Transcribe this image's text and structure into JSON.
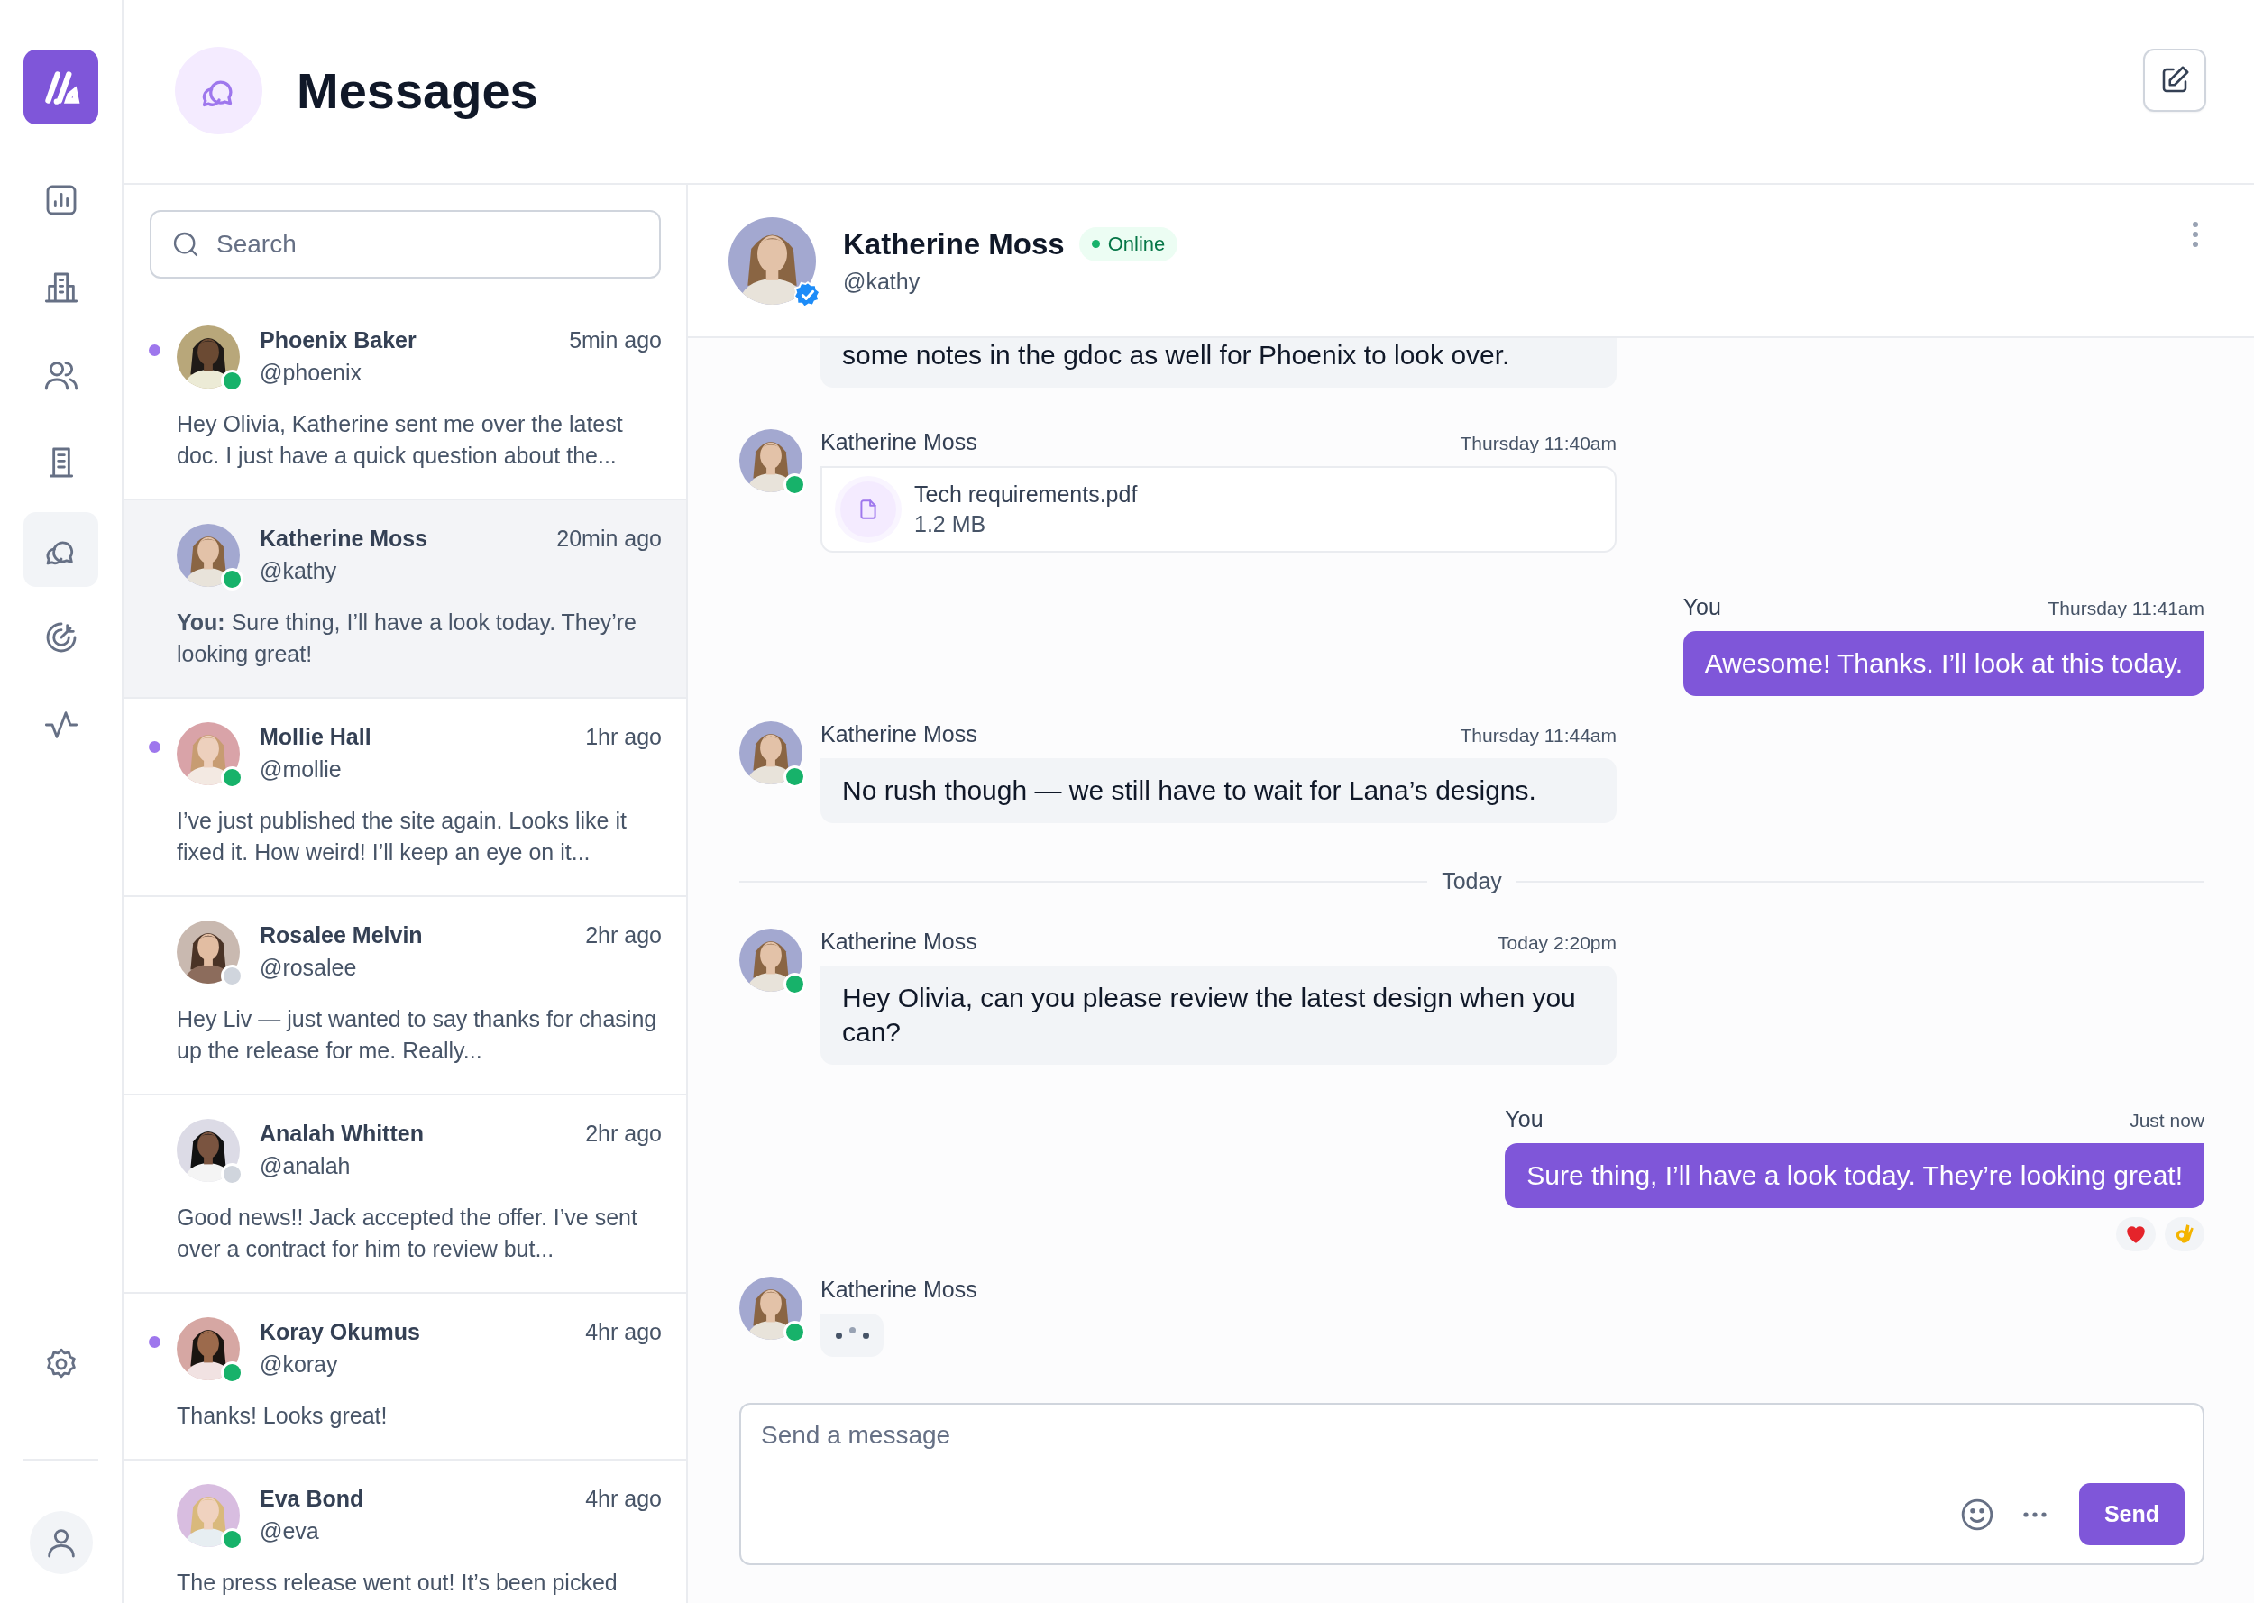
{
  "nav": [
    {
      "kind": "chart",
      "selected": false
    },
    {
      "kind": "building",
      "selected": false
    },
    {
      "kind": "users",
      "selected": false
    },
    {
      "kind": "document",
      "selected": false
    },
    {
      "kind": "messages",
      "selected": true
    },
    {
      "kind": "target",
      "selected": false
    },
    {
      "kind": "activity",
      "selected": false
    }
  ],
  "page_title": "Messages",
  "search": {
    "placeholder": "Search"
  },
  "conversations": [
    {
      "name": "Phoenix Baker",
      "handle": "@phoenix",
      "time": "5min ago",
      "preview": "Hey Olivia, Katherine sent me over the latest doc. I just have a quick question about the...",
      "unread": true,
      "online": true,
      "selected": false
    },
    {
      "name": "Katherine Moss",
      "handle": "@kathy",
      "time": "20min ago",
      "preview": "**You:** Sure thing, I’ll have a look today. They’re looking great!",
      "unread": false,
      "online": true,
      "selected": true
    },
    {
      "name": "Mollie Hall",
      "handle": "@mollie",
      "time": "1hr ago",
      "preview": "I’ve just published the site again. Looks like it fixed it. How weird! I’ll keep an eye on it...",
      "unread": true,
      "online": true,
      "selected": false
    },
    {
      "name": "Rosalee Melvin",
      "handle": "@rosalee",
      "time": "2hr ago",
      "preview": "Hey Liv — just wanted to say thanks for chasing up the release for me. Really...",
      "unread": false,
      "online": false,
      "selected": false
    },
    {
      "name": "Analah Whitten",
      "handle": "@analah",
      "time": "2hr ago",
      "preview": "Good news!! Jack accepted the offer. I’ve sent over a contract for him to review but...",
      "unread": false,
      "online": false,
      "selected": false
    },
    {
      "name": "Koray Okumus",
      "handle": "@koray",
      "time": "4hr ago",
      "preview": "Thanks! Looks great!",
      "unread": true,
      "online": true,
      "selected": false
    },
    {
      "name": "Eva Bond",
      "handle": "@eva",
      "time": "4hr ago",
      "preview": "The press release went out! It’s been picked",
      "unread": false,
      "online": true,
      "selected": false
    }
  ],
  "chat": {
    "name": "Katherine Moss",
    "status": "Online",
    "handle": "@kathy",
    "verified": true
  },
  "messages": [
    {
      "kind": "incoming",
      "text": "some notes in the gdoc as well for Phoenix to look over."
    },
    {
      "kind": "file",
      "sender": "Katherine Moss",
      "time": "Thursday 11:40am",
      "online": true,
      "file_name": "Tech requirements.pdf",
      "file_size": "1.2 MB"
    },
    {
      "kind": "outgoing",
      "sender": "You",
      "time": "Thursday 11:41am",
      "text": "Awesome! Thanks. I’ll look at this today."
    },
    {
      "kind": "incoming",
      "sender": "Katherine Moss",
      "time": "Thursday 11:44am",
      "online": true,
      "text": "No rush though — we still have to wait for Lana’s designs."
    },
    {
      "kind": "divider",
      "label": "Today"
    },
    {
      "kind": "incoming",
      "sender": "Katherine Moss",
      "time": "Today 2:20pm",
      "online": true,
      "text": "Hey Olivia, can you please review the latest design when you can?"
    },
    {
      "kind": "outgoing",
      "sender": "You",
      "time": "Just now",
      "text": "Sure thing, I’ll have a look today. They’re looking great!",
      "reactions": [
        {
          "kind": "heart"
        },
        {
          "kind": "ok-hand"
        }
      ]
    },
    {
      "kind": "typing",
      "sender": "Katherine Moss",
      "online": true
    }
  ],
  "composer": {
    "placeholder": "Send a message",
    "send": "Send"
  }
}
